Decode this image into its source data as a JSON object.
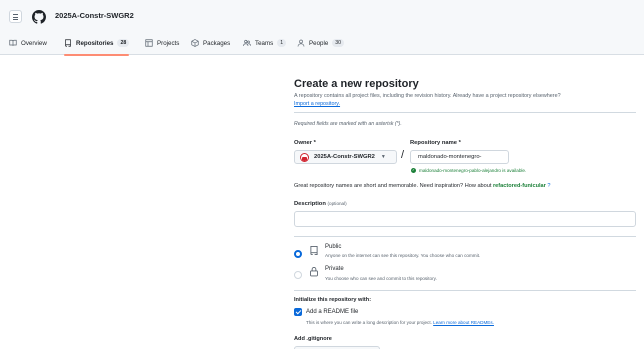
{
  "header": {
    "org_name": "2025A-Constr-SWGR2"
  },
  "nav": {
    "tabs": [
      {
        "label": "Overview",
        "icon": "book-icon"
      },
      {
        "label": "Repositories",
        "icon": "repo-icon",
        "count": "28",
        "active": true
      },
      {
        "label": "Projects",
        "icon": "table-icon"
      },
      {
        "label": "Packages",
        "icon": "package-icon"
      },
      {
        "label": "Teams",
        "icon": "people-icon",
        "count": "1"
      },
      {
        "label": "People",
        "icon": "person-icon",
        "count": "30"
      }
    ]
  },
  "form": {
    "title": "Create a new repository",
    "description": "A repository contains all project files, including the revision history. Already have a project repository elsewhere?",
    "import_link": "Import a repository.",
    "required_note": "Required fields are marked with an asterisk (*).",
    "owner_label": "Owner *",
    "owner_value": "2025A-Constr-SWGR2",
    "repo_label": "Repository name *",
    "repo_value": "maldonado-montenegro-",
    "slash": "/",
    "availability": "maldonado-montenegro-pablo-alejandro is available.",
    "hint_prefix": "Great repository names are short and memorable. Need inspiration? How about",
    "hint_suggestion": "refactored-funicular",
    "hint_suffix": "?",
    "description_label": "Description",
    "description_optional": "(optional)",
    "description_value": "",
    "visibility": {
      "public_title": "Public",
      "public_desc": "Anyone on the internet can see this repository. You choose who can commit.",
      "private_title": "Private",
      "private_desc": "You choose who can see and commit to this repository.",
      "selected": "public"
    },
    "init_title": "Initialize this repository with:",
    "readme_label": "Add a README file",
    "readme_desc": "This is where you can write a long description for your project.",
    "readme_link": "Learn more about READMEs.",
    "readme_checked": true,
    "gitignore_title": "Add .gitignore"
  },
  "colors": {
    "accent": "#0969da",
    "success": "#1a7f37",
    "tab_underline": "#fd8c73"
  }
}
